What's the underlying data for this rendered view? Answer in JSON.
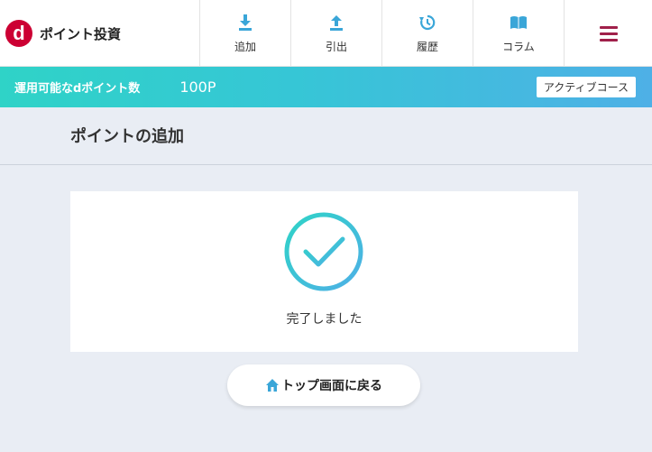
{
  "header": {
    "brand_logo_letter": "d",
    "brand_title": "ポイント投資",
    "nav": [
      {
        "label": "追加",
        "icon": "download-icon"
      },
      {
        "label": "引出",
        "icon": "upload-icon"
      },
      {
        "label": "履歴",
        "icon": "history-icon"
      },
      {
        "label": "コラム",
        "icon": "book-icon"
      }
    ],
    "menu_icon": "hamburger-menu-icon"
  },
  "points_bar": {
    "label": "運用可能なdポイント数",
    "value": "100P",
    "course_badge": "アクティブコース"
  },
  "page": {
    "title": "ポイントの追加"
  },
  "result": {
    "status_icon": "check-circle-icon",
    "message": "完了しました"
  },
  "actions": {
    "back_label": "トップ画面に戻る",
    "back_icon": "home-icon"
  },
  "colors": {
    "brand": "#cc0033",
    "accent": "#3bbfd8",
    "menu": "#a0204a",
    "background": "#e9edf4"
  }
}
